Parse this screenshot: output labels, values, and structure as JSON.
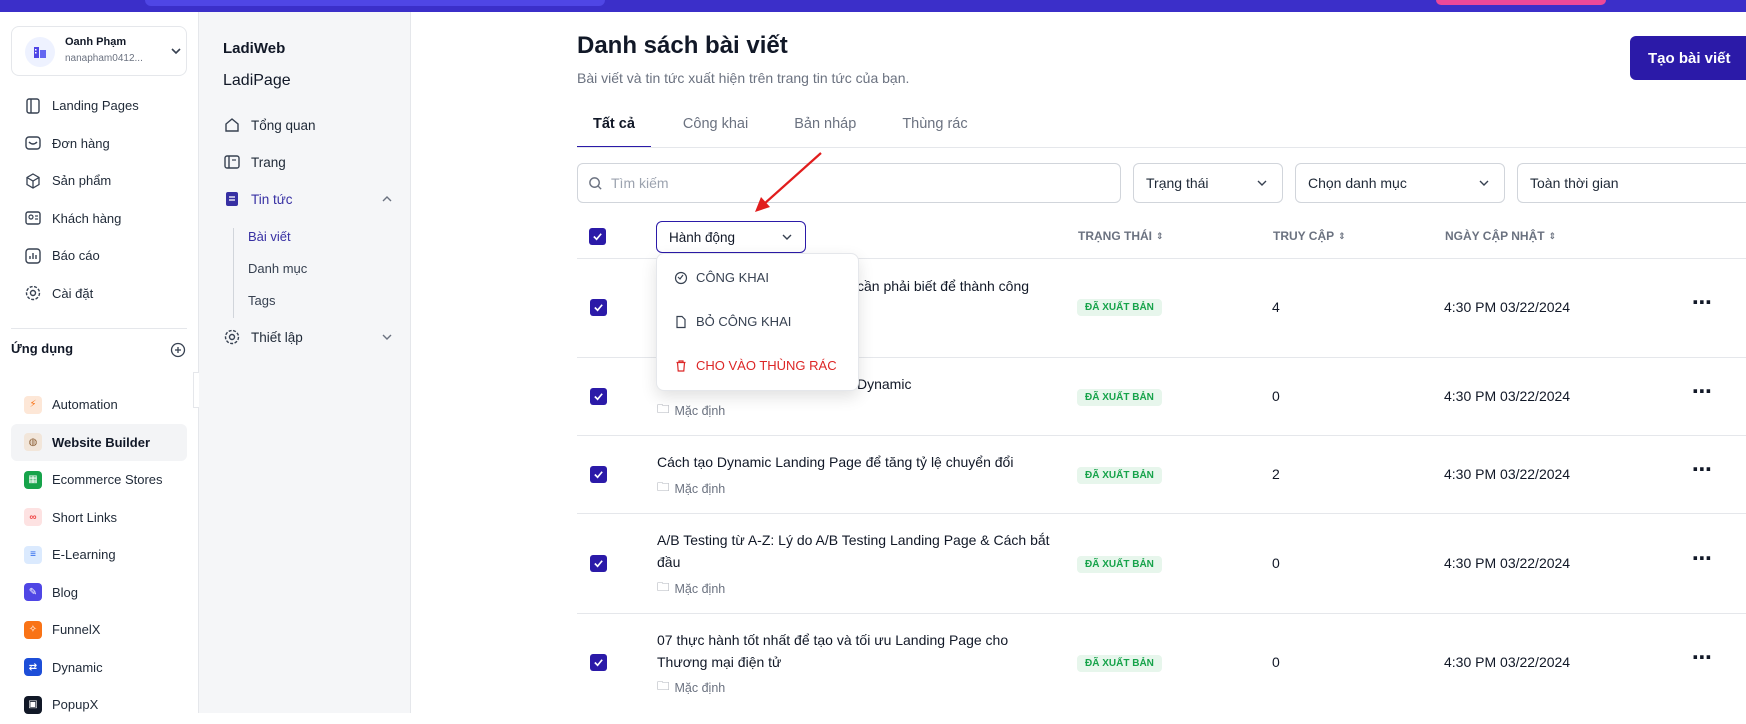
{
  "account": {
    "name": "Oanh Phạm",
    "email": "nanapham0412..."
  },
  "nav": [
    {
      "label": "Landing Pages",
      "icon": "landing-pages-icon"
    },
    {
      "label": "Đơn hàng",
      "icon": "orders-icon"
    },
    {
      "label": "Sản phẩm",
      "icon": "products-icon"
    },
    {
      "label": "Khách hàng",
      "icon": "customers-icon"
    },
    {
      "label": "Báo cáo",
      "icon": "reports-icon"
    },
    {
      "label": "Cài đặt",
      "icon": "settings-icon"
    }
  ],
  "apps": {
    "title": "Ứng dụng",
    "items": [
      {
        "label": "Automation",
        "color": "#f97316"
      },
      {
        "label": "Website Builder",
        "color": "#8b5e34"
      },
      {
        "label": "Ecommerce Stores",
        "color": "#16a34a"
      },
      {
        "label": "Short Links",
        "color": "#ef4444"
      },
      {
        "label": "E-Learning",
        "color": "#2563eb"
      },
      {
        "label": "Blog",
        "color": "#4f46e5"
      },
      {
        "label": "FunnelX",
        "color": "#f97316"
      },
      {
        "label": "Dynamic",
        "color": "#1d4ed8"
      },
      {
        "label": "PopupX",
        "color": "#111827"
      }
    ]
  },
  "side2": {
    "brand": "LadiWeb",
    "site": "LadiPage",
    "items": {
      "overview": "Tổng quan",
      "pages": "Trang",
      "news": "Tin tức",
      "setup": "Thiết lập"
    },
    "sub": {
      "posts": "Bài viết",
      "categories": "Danh mục",
      "tags": "Tags"
    }
  },
  "main": {
    "title": "Danh sách bài viết",
    "subtitle": "Bài viết và tin tức xuất hiện trên trang tin tức của bạn.",
    "create_label": "Tạo bài viết",
    "tabs": [
      "Tất cả",
      "Công khai",
      "Bản nháp",
      "Thùng rác"
    ],
    "search_placeholder": "Tìm kiếm",
    "filters": {
      "status": "Trạng thái",
      "category": "Chọn danh mục",
      "time": "Toàn thời gian"
    },
    "action_label": "Hành động",
    "columns": {
      "status": "TRẠNG THÁI",
      "views": "TRUY CẬP",
      "updated": "NGÀY CẬP NHẬT"
    },
    "menu": {
      "publish": "CÔNG KHAI",
      "unpublish": "BỎ CÔNG KHAI",
      "trash": "CHO VÀO THÙNG RÁC"
    },
    "rows": [
      {
        "title": "cần phải biết để thành công",
        "category": "",
        "status": "ĐÃ XUẤT BẢN",
        "views": "4",
        "date": "4:30 PM 03/22/2024"
      },
      {
        "title": "Dynamic",
        "category": "Mặc định",
        "status": "ĐÃ XUẤT BẢN",
        "views": "0",
        "date": "4:30 PM 03/22/2024"
      },
      {
        "title": "Cách tạo Dynamic Landing Page để tăng tỷ lệ chuyển đổi",
        "category": "Mặc định",
        "status": "ĐÃ XUẤT BẢN",
        "views": "2",
        "date": "4:30 PM 03/22/2024"
      },
      {
        "title": "A/B Testing từ A-Z: Lý do A/B Testing Landing Page & Cách bắt đầu",
        "category": "Mặc định",
        "status": "ĐÃ XUẤT BẢN",
        "views": "0",
        "date": "4:30 PM 03/22/2024"
      },
      {
        "title": "07 thực hành tốt nhất để tạo và tối ưu Landing Page cho Thương mại điện tử",
        "category": "Mặc định",
        "status": "ĐÃ XUẤT BẢN",
        "views": "0",
        "date": "4:30 PM 03/22/2024"
      }
    ],
    "more_glyph": "⋯"
  }
}
